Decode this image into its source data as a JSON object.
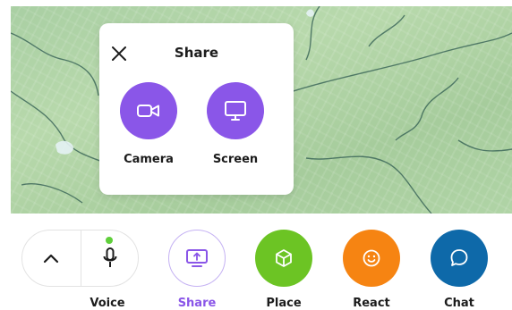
{
  "popup": {
    "title": "Share",
    "options": [
      {
        "label": "Camera",
        "icon": "video-camera-icon"
      },
      {
        "label": "Screen",
        "icon": "monitor-icon"
      }
    ]
  },
  "toolbar": {
    "voice_label": "Voice",
    "share_label": "Share",
    "place_label": "Place",
    "react_label": "React",
    "chat_label": "Chat"
  },
  "colors": {
    "purple": "#8a56e8",
    "green": "#6cc424",
    "orange": "#f68412",
    "blue": "#0e69a9",
    "mic_status": "#5fcf3a"
  }
}
